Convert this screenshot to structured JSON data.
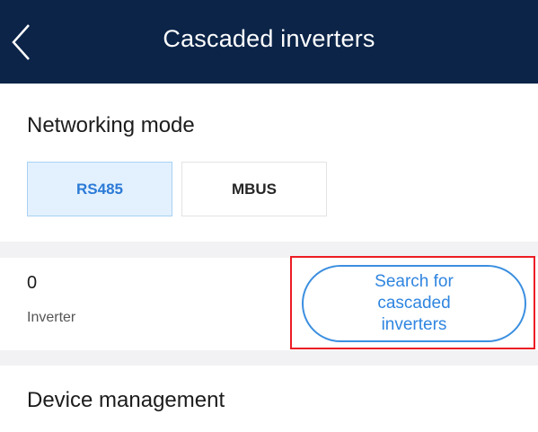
{
  "header": {
    "title": "Cascaded inverters",
    "back_icon": "chevron-left-icon",
    "background_color": "#0b2448"
  },
  "networking": {
    "label": "Networking mode",
    "options": [
      {
        "label": "RS485",
        "selected": true
      },
      {
        "label": "MBUS",
        "selected": false
      }
    ],
    "accent_color": "#2b7ad6"
  },
  "inverters": {
    "count": "0",
    "count_label": "Inverter",
    "search_button_lines": [
      "Search for",
      "cascaded",
      "inverters"
    ]
  },
  "device_management": {
    "label": "Device management"
  }
}
